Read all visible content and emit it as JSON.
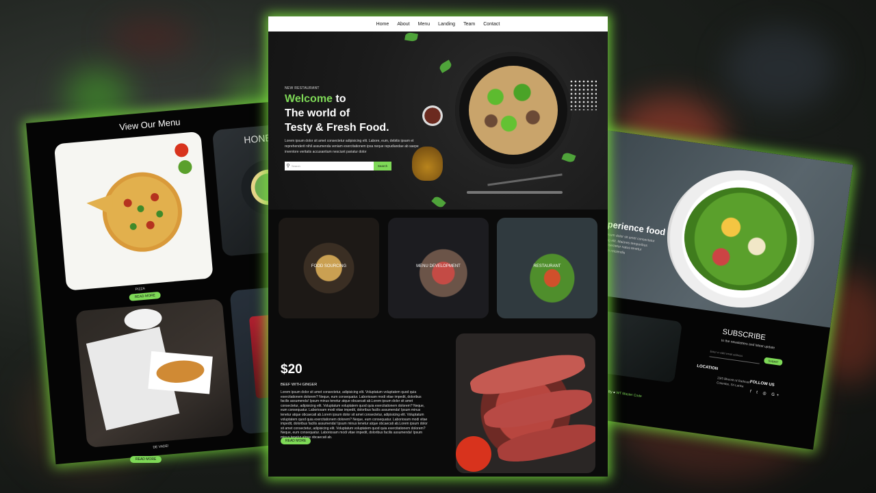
{
  "colors": {
    "accent": "#7ed957",
    "background": "#0b0b0b"
  },
  "nav": [
    "Home",
    "About",
    "Menu",
    "Landing",
    "Team",
    "Contact"
  ],
  "hero": {
    "eyebrow": "NEW RESTAURANT",
    "title_accent": "Welcome",
    "title_rest1": "to",
    "title_line2": "The world of",
    "title_line3": "Testy & Fresh Food.",
    "body": "Lorem ipsum dolor sit amet consectetur adipisicing elit. Labore, eum, debitis ipsam et reprehenderit nihil assumenda veniam exercitationem ipsa neque repudiandae ab saepe inventore veritatis accusantium nesciunt pariatur dolor",
    "search_placeholder": "Search",
    "search_button": "Search",
    "search_icon": "search-icon"
  },
  "categories": [
    "FOOD SOURCING",
    "MENU DEVELOPMENT",
    "RESTAURANT"
  ],
  "dish": {
    "price": "$20",
    "name": "BEEF WITH GINGER",
    "description": "Lorem ipsum dolor sit amet consectetur, adipisicing elit. Voluptatum voluptatem quod quia exercitationem dolorem? Neque, eum consequatur. Laboriosam modi vitae impedit, doloribus facilis assumenda! Ipsum minus tenetur atque obcaecati ab.Lorem ipsum dolor sit amet consectetur, adipisicing elit. Voluptatum voluptatem quod quia exercitationem dolorem? Neque, eum consequatur. Laboriosam modi vitae impedit, doloribus facilis assumenda! Ipsum minus tenetur atque obcaecati ab.Lorem ipsum dolor sit amet consectetur, adipisicing elit. Voluptatum voluptatem quod quia exercitationem dolorem? Neque, eum consequatur. Laboriosam modi vitae impedit, doloribus facilis assumenda! Ipsum minus tenetur atque obcaecati ab.Lorem ipsum dolor sit amet consectetur, adipisicing elit. Voluptatum voluptatem quod quia exercitationem dolorem? Neque, eum consequatur. Laboriosam modi vitae impedit, doloribus facilis assumenda! Ipsum minus tenetur atque obcaecati ab.",
    "button": "READ MORE"
  },
  "left_page": {
    "title": "View Our Menu",
    "item1_label": "PIZZA",
    "item1_button": "READ MORE",
    "item2_label": "DE VADE!",
    "item2_button": "READ MORE",
    "magazine_text": "HONE"
  },
  "right_page": {
    "hero_title": "Experience food",
    "hero_body": "Lorem ipsum dolor sit amet consectetur adipisicing elit. Maiores temporibus facilis consectetur natus tenetur voluptatem reiciendis",
    "subscribe_title": "SUBSCRIBE",
    "subscribe_sub": "to the newsletters and latest update",
    "subscribe_placeholder": "Enter a valid email address",
    "subscribe_button": "SUBMIT",
    "location_title": "LOCATION",
    "location_text": "23/5 Bhernit rd Rathnam Colombo, Sri Lanka",
    "follow_title": "FOLLOW US",
    "social": "f t ◎ G+",
    "design_prefix": "Design By ●",
    "design_name": "WT Master Code"
  }
}
